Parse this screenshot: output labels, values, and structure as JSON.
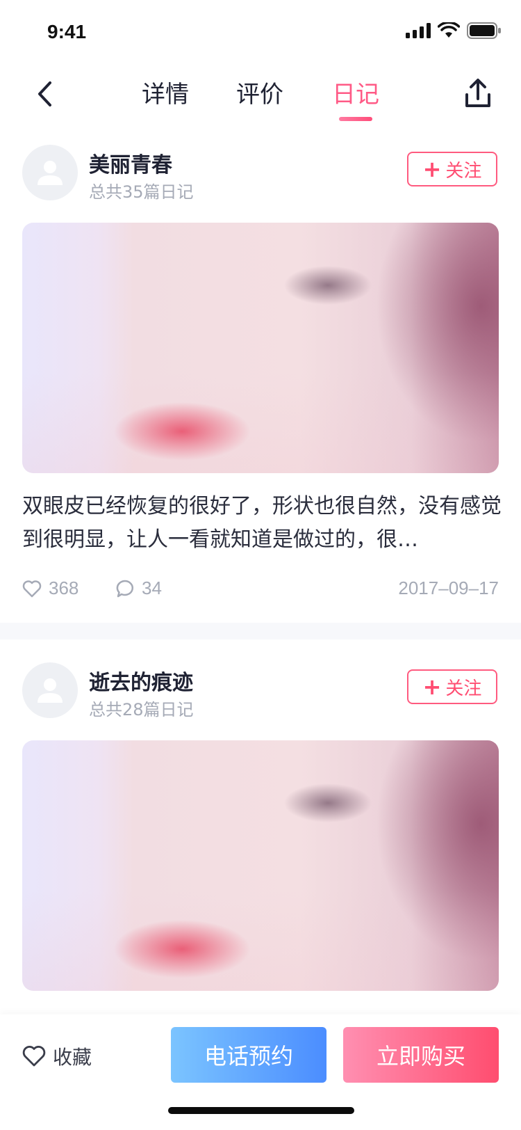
{
  "status_bar": {
    "time": "9:41"
  },
  "nav": {
    "tabs": [
      {
        "label": "详情"
      },
      {
        "label": "评价"
      },
      {
        "label": "日记"
      }
    ],
    "active_tab": "日记",
    "accent_color": "#ff5a86"
  },
  "posts": [
    {
      "username": "美丽青春",
      "diary_count": "总共35篇日记",
      "follow_label": "关注",
      "text": "双眼皮已经恢复的很好了，形状也很自然，没有感觉到很明显，让人一看就知道是做过的，很…",
      "likes": "368",
      "comments": "34",
      "date": "2017–09–17"
    },
    {
      "username": "逝去的痕迹",
      "diary_count": "总共28篇日记",
      "follow_label": "关注"
    }
  ],
  "bottom_bar": {
    "favorite_label": "收藏",
    "call_label": "电话预约",
    "buy_label": "立即购买"
  }
}
